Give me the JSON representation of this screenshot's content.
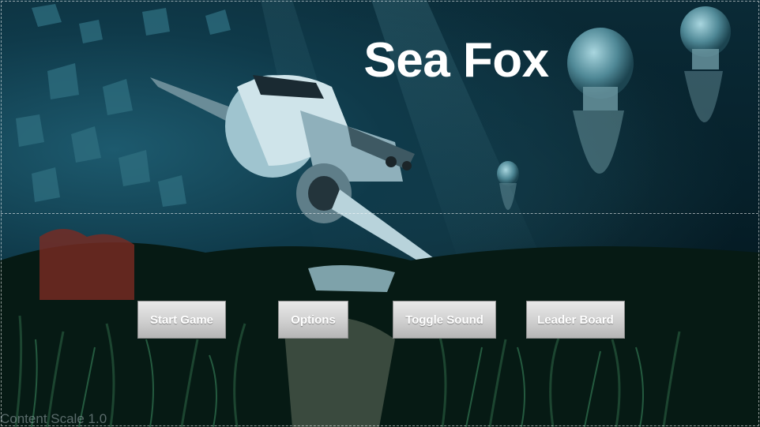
{
  "title": "Sea Fox",
  "menu": {
    "start_label": "Start Game",
    "options_label": "Options",
    "sound_label": "Toggle Sound",
    "leaderboard_label": "Leader Board"
  },
  "debug": {
    "content_scale": "Content Scale 1.0"
  },
  "colors": {
    "title_text": "#ffffff",
    "button_face": "#d0d0d0",
    "water": "#0f3a4a"
  }
}
